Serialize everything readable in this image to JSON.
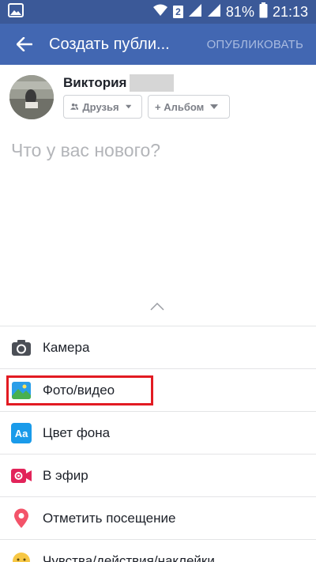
{
  "status_bar": {
    "sim_badge": "2",
    "battery_percent": "81%",
    "time": "21:13"
  },
  "app_bar": {
    "title": "Создать публи...",
    "publish_label": "ОПУБЛИКОВАТЬ"
  },
  "composer": {
    "user_name": "Виктория",
    "audience_label": "Друзья",
    "album_label": "+ Альбом",
    "placeholder": "Что у вас нового?"
  },
  "menu": {
    "items": [
      {
        "label": "Камера",
        "icon": "camera-icon"
      },
      {
        "label": "Фото/видео",
        "icon": "photo-video-icon",
        "highlighted": true,
        "highlight_color": "#e21b22"
      },
      {
        "label": "Цвет фона",
        "icon": "background-color-icon"
      },
      {
        "label": "В эфир",
        "icon": "live-icon"
      },
      {
        "label": "Отметить посещение",
        "icon": "location-pin-icon"
      },
      {
        "label": "Чувства/действия/наклейки",
        "icon": "emoji-icon"
      }
    ]
  },
  "colors": {
    "status_bar": "#3b5998",
    "app_bar": "#4267b2",
    "highlight": "#e21b22"
  }
}
